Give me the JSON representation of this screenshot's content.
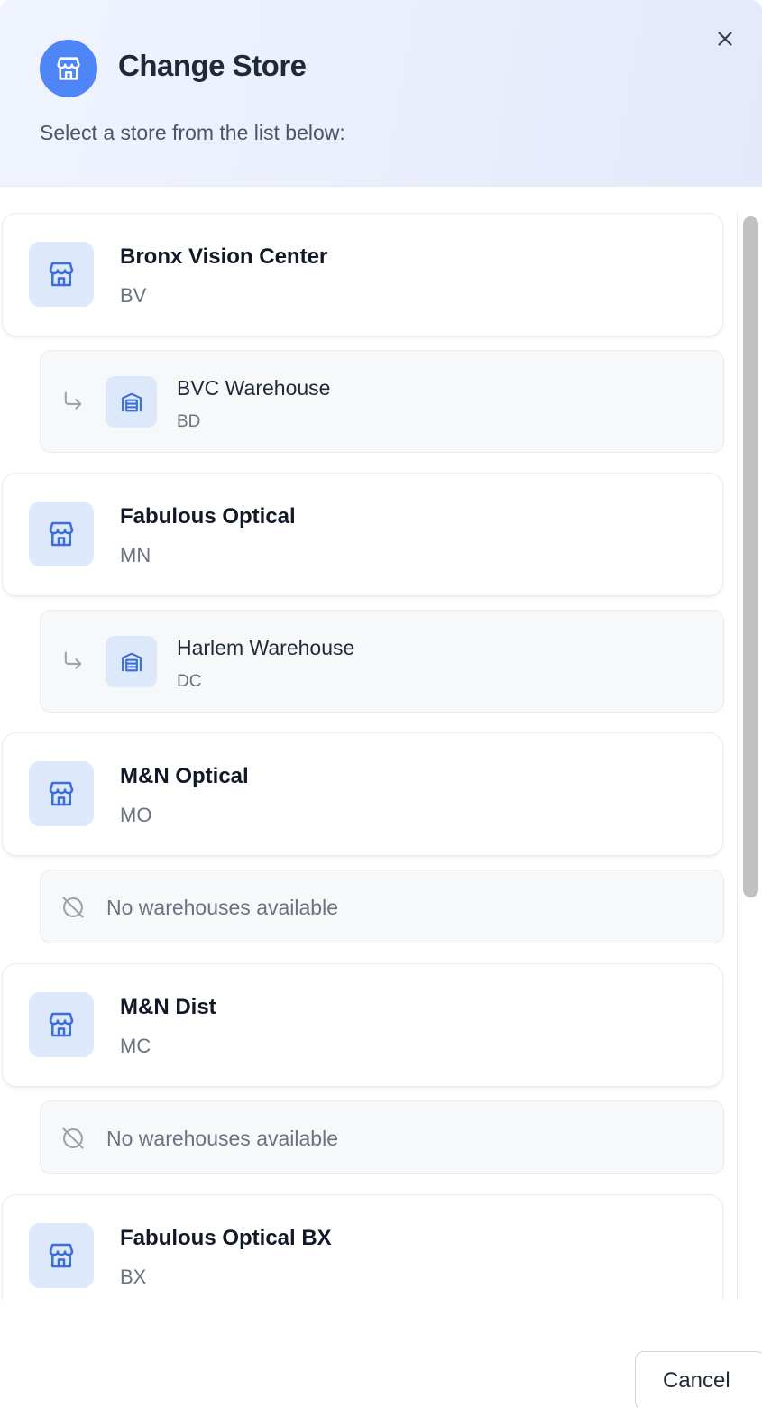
{
  "header": {
    "title": "Change Store",
    "subtitle": "Select a store from the list below:",
    "icon": "store-icon",
    "close_icon": "close-icon"
  },
  "stores": [
    {
      "name": "Bronx Vision Center",
      "code": "BV",
      "warehouses": [
        {
          "name": "BVC Warehouse",
          "code": "BD"
        }
      ]
    },
    {
      "name": "Fabulous Optical",
      "code": "MN",
      "warehouses": [
        {
          "name": "Harlem Warehouse",
          "code": "DC"
        }
      ]
    },
    {
      "name": "M&N Optical",
      "code": "MO",
      "warehouses": [],
      "empty_text": "No warehouses available"
    },
    {
      "name": "M&N Dist",
      "code": "MC",
      "warehouses": [],
      "empty_text": "No warehouses available"
    },
    {
      "name": "Fabulous Optical BX",
      "code": "BX",
      "warehouses": []
    }
  ],
  "footer": {
    "cancel_label": "Cancel"
  },
  "colors": {
    "accent": "#4f86f7",
    "icon_tile": "#dde8fb",
    "icon_stroke": "#3b6fd9",
    "muted_text": "#6b7280"
  }
}
